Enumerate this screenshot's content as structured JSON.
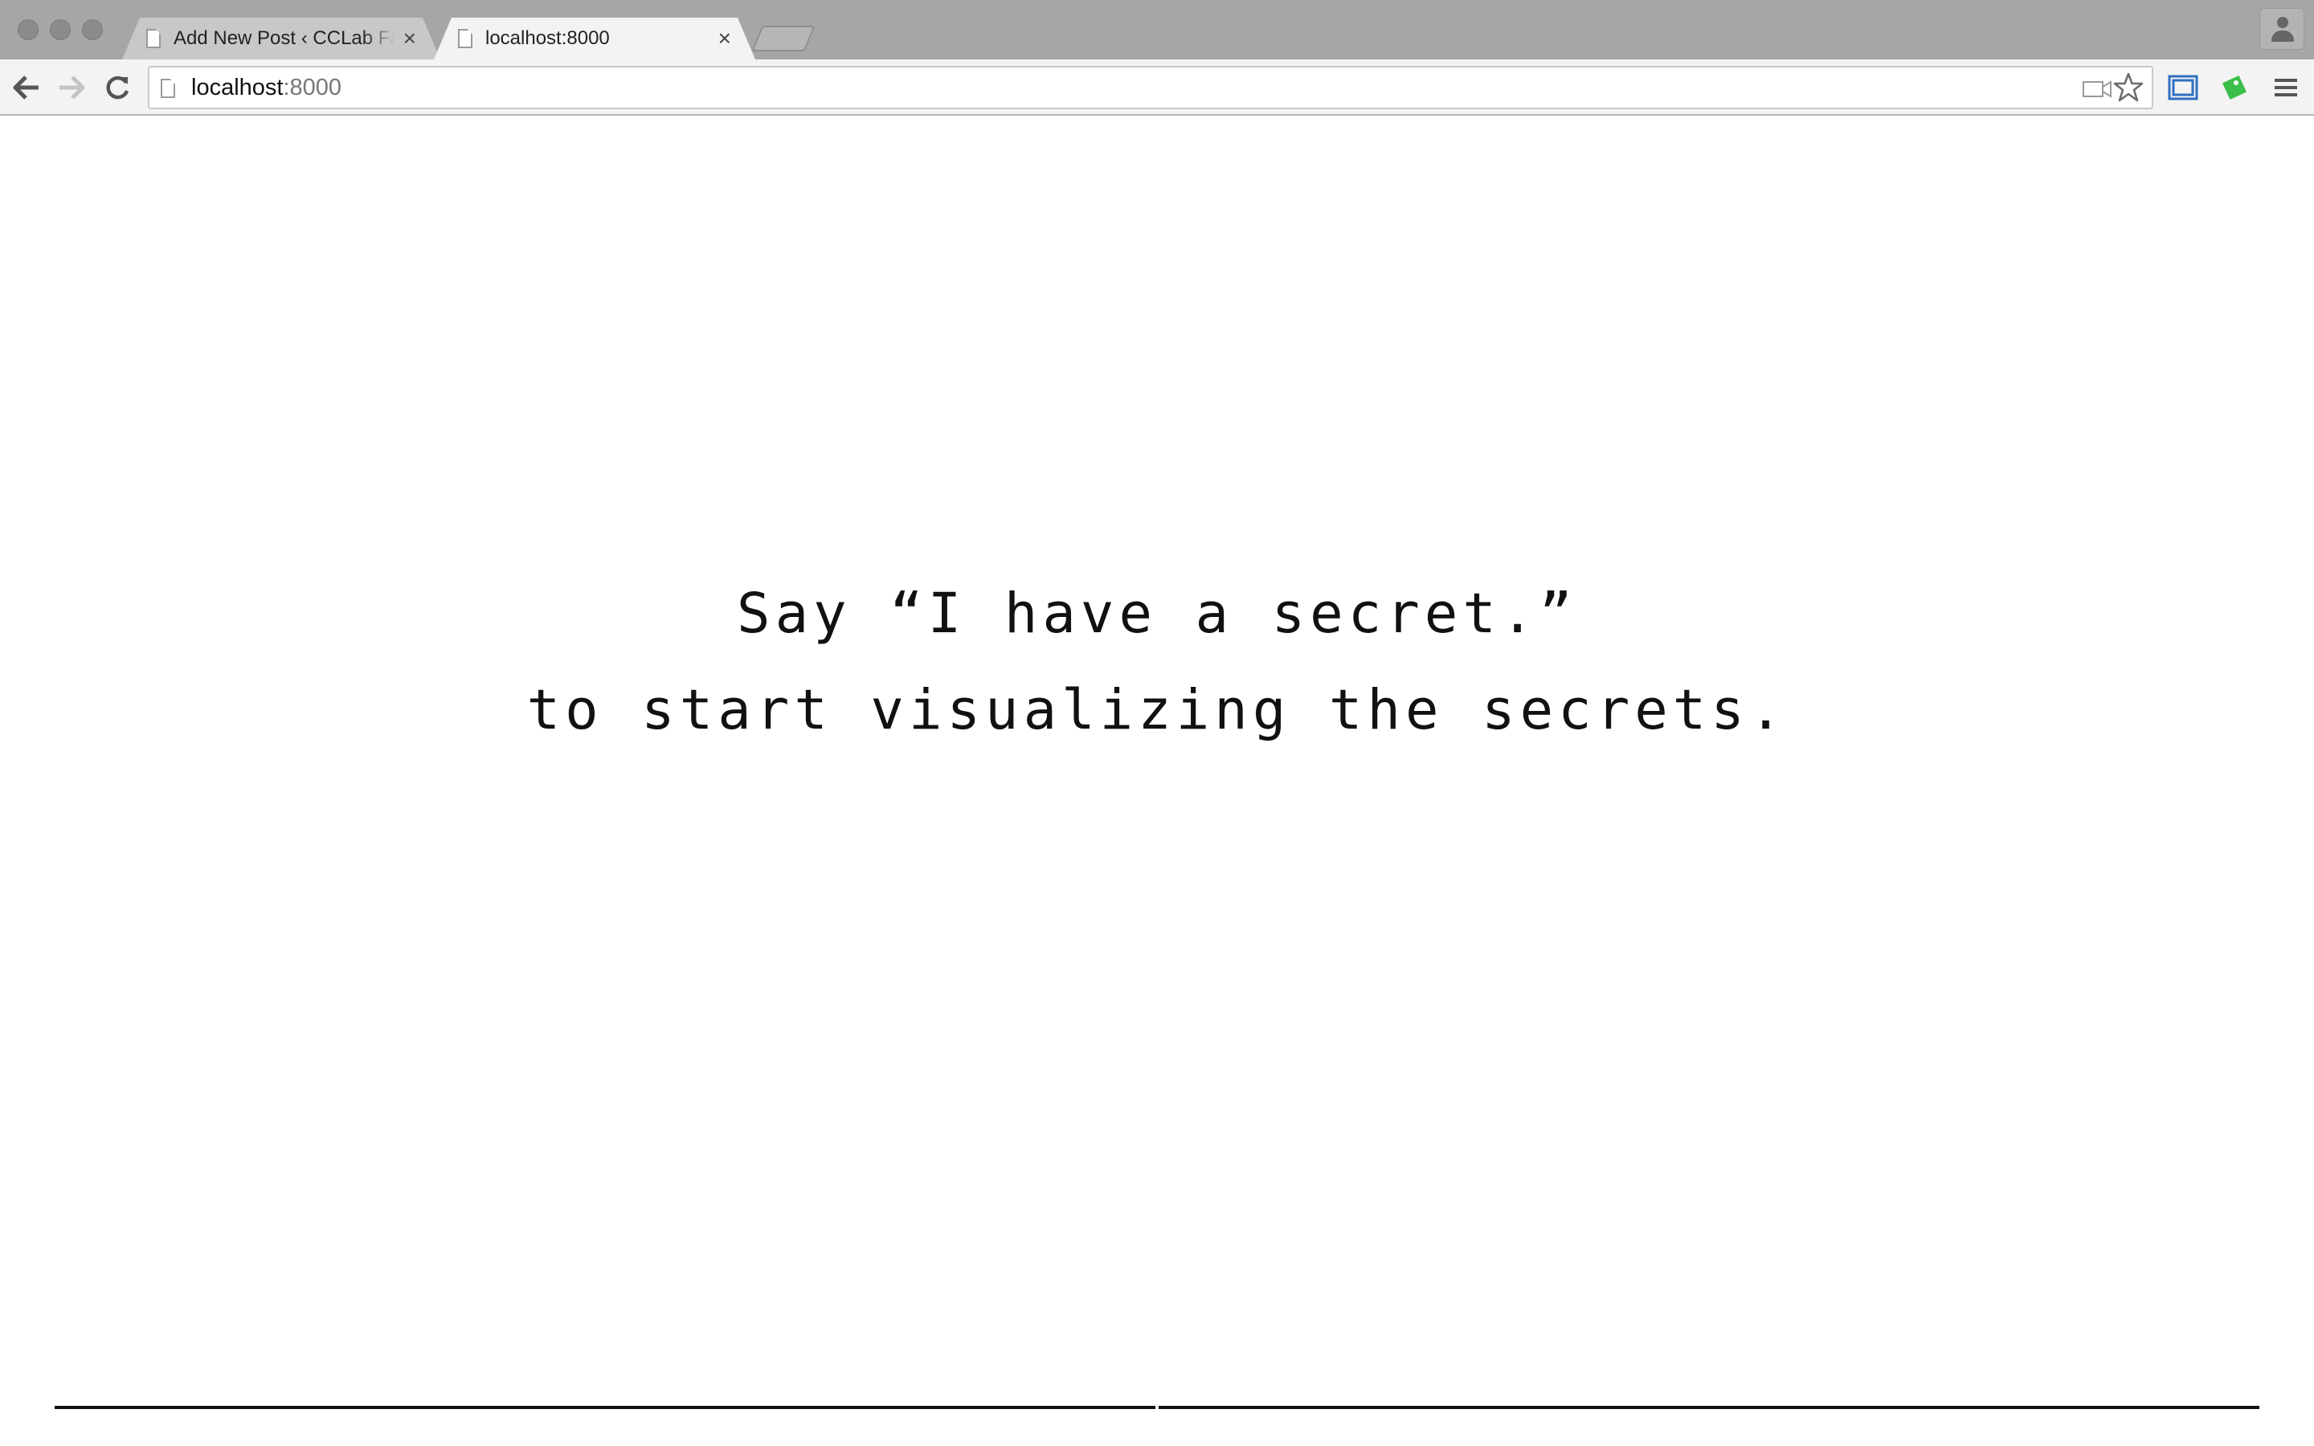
{
  "browser": {
    "tabs": [
      {
        "title": "Add New Post ‹ CCLab Fall",
        "close_glyph": "×",
        "active": false
      },
      {
        "title": "localhost:8000",
        "close_glyph": "×",
        "active": true
      }
    ],
    "omnibox": {
      "host": "localhost",
      "port": ":8000"
    },
    "icons": {
      "back": "back-arrow-icon",
      "forward": "forward-arrow-icon",
      "reload": "reload-icon",
      "page": "document-icon",
      "camera": "camera-icon",
      "bookmark": "star-icon",
      "screencast": "screen-capture-icon",
      "extension": "green-tag-icon",
      "menu": "hamburger-menu-icon",
      "profile": "person-icon"
    },
    "colors": {
      "extension": "#3cbf4a",
      "screencast": "#2f6fc1"
    }
  },
  "page": {
    "lines": [
      "Say “I have a secret.”",
      "to start visualizing the secrets."
    ]
  }
}
